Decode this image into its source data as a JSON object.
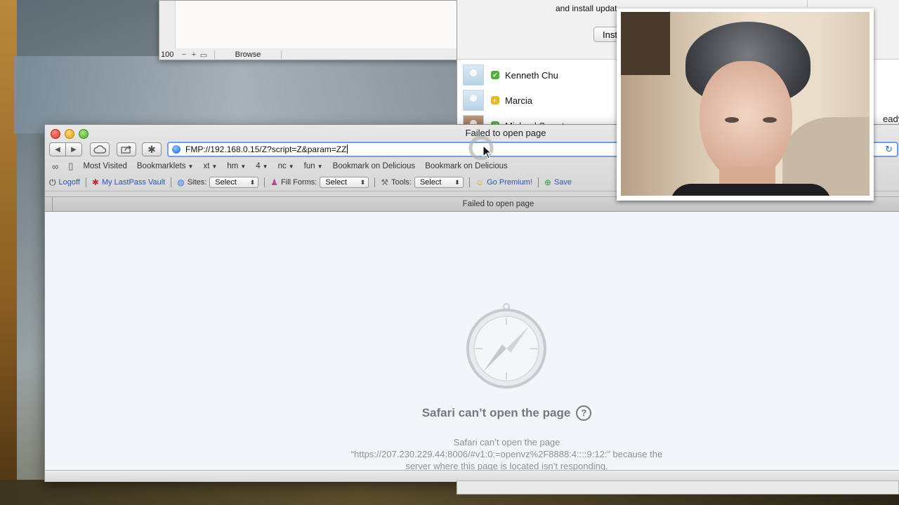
{
  "filemaker": {
    "zoom": "100",
    "mode": "Browse"
  },
  "messenger": {
    "banner_text": "and install updat",
    "install_button": "Inst",
    "partial_right_text": "eady?",
    "contacts": [
      {
        "name": "Kenneth Chu",
        "status": "green"
      },
      {
        "name": "Marcia",
        "status": "yellow"
      },
      {
        "name": "Michael Swanton",
        "status": "green"
      }
    ]
  },
  "safari": {
    "window_title": "Failed to open page",
    "url": "FMP://192.168.0.15/Z?script=Z&param=ZZ",
    "bookmarks": [
      {
        "label": "Most Visited",
        "arrow": false
      },
      {
        "label": "Bookmarklets",
        "arrow": true
      },
      {
        "label": "xt",
        "arrow": true
      },
      {
        "label": "hm",
        "arrow": true
      },
      {
        "label": "4",
        "arrow": true
      },
      {
        "label": "nc",
        "arrow": true
      },
      {
        "label": "fun",
        "arrow": true
      },
      {
        "label": "Bookmark on Delicious",
        "arrow": false
      },
      {
        "label": "Bookmark on Delicious",
        "arrow": false
      }
    ],
    "lastpass": {
      "logoff": "Logoff",
      "vault": "My LastPass Vault",
      "sites_label": "Sites:",
      "sites_value": "Select",
      "fill_label": "Fill Forms:",
      "fill_value": "Select",
      "tools_label": "Tools:",
      "tools_value": "Select",
      "premium": "Go Premium!",
      "save": "Save"
    },
    "tab_title": "Failed to open page",
    "error_title": "Safari can’t open the page",
    "error_line1": "Safari can’t open the page",
    "error_line2": "“https://207.230.229.44:8006/#v1:0:=openvz%2F8888:4::::9:12:” because the",
    "error_line3": "server where this page is located isn’t responding."
  },
  "icons": {
    "back": "back-arrow-icon",
    "forward": "forward-arrow-icon",
    "cloud": "icloud-tabs-icon",
    "share": "share-icon",
    "extension": "extension-icon",
    "globe": "globe-icon",
    "reload": "reload-icon",
    "compass": "safari-compass-icon",
    "help": "help-icon"
  },
  "colors": {
    "url_focus": "#6ea1e3",
    "link_blue": "#2b55a8",
    "error_text": "#707a80"
  }
}
